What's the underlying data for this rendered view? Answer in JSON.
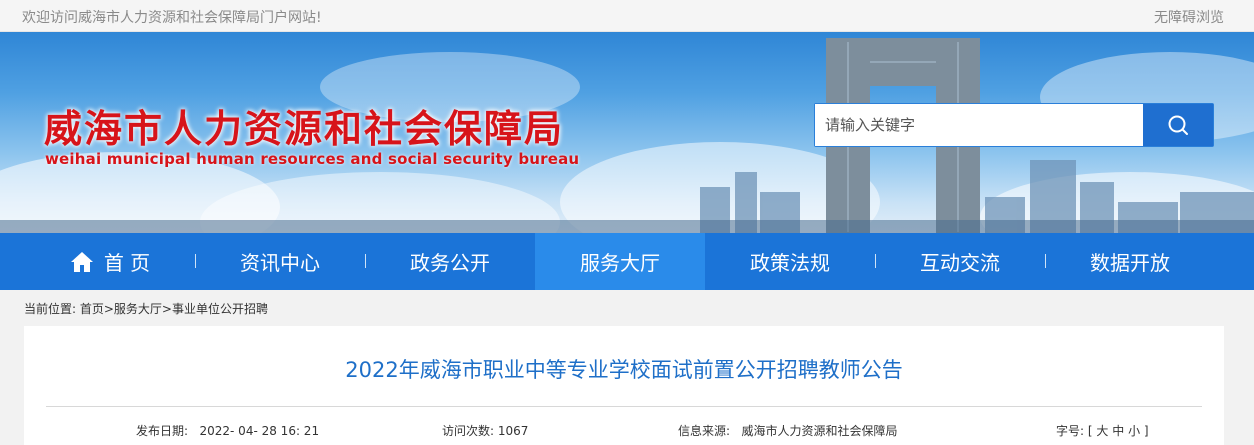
{
  "topbar": {
    "welcome": "欢迎访问威海市人力资源和社会保障局门户网站!",
    "accessibility": "无障碍浏览"
  },
  "banner": {
    "title_cn": "威海市人力资源和社会保障局",
    "title_en": "weihai municipal human resources and social security bureau"
  },
  "search": {
    "placeholder": "请输入关键字"
  },
  "nav": {
    "items": [
      {
        "label": "首 页"
      },
      {
        "label": "资讯中心"
      },
      {
        "label": "政务公开"
      },
      {
        "label": "服务大厅",
        "active": true
      },
      {
        "label": "政策法规"
      },
      {
        "label": "互动交流"
      },
      {
        "label": "数据开放"
      }
    ]
  },
  "breadcrumb": {
    "prefix": "当前位置:",
    "path": "首页>服务大厅>事业单位公开招聘"
  },
  "article": {
    "title": "2022年威海市职业中等专业学校面试前置公开招聘教师公告",
    "publish_label": "发布日期:",
    "publish_value": "2022- 04- 28 16: 21",
    "visits_label": "访问次数:",
    "visits_value": "1067",
    "source_label": "信息来源:",
    "source_value": "威海市人力资源和社会保障局",
    "fontsize_label": "字号:",
    "fontsize_open": "[",
    "fontsize_large": "大",
    "fontsize_medium": "中",
    "fontsize_small": "小",
    "fontsize_close": "]"
  },
  "colors": {
    "nav_bg": "#1b74d8",
    "nav_active": "#2a8bea",
    "title_red": "#d7141a",
    "headline_blue": "#1e6fc8"
  }
}
